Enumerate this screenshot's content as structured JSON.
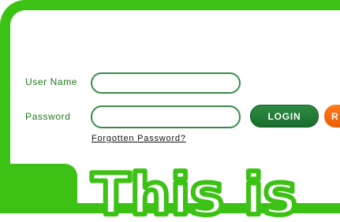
{
  "login": {
    "username_label": "User Name",
    "password_label": "Password",
    "username_value": "",
    "password_value": "",
    "login_button": "LOGIN",
    "second_button_visible_text": "R",
    "forgot_link": "Forgotten Password?"
  },
  "banner": {
    "text": "This is",
    "stroke_color": "#3cc214"
  },
  "colors": {
    "frame": "#3cc214",
    "label": "#1e7a1e",
    "field_border": "#3a8b4b",
    "login_button": "#237c37",
    "second_button": "#f26c0d"
  }
}
